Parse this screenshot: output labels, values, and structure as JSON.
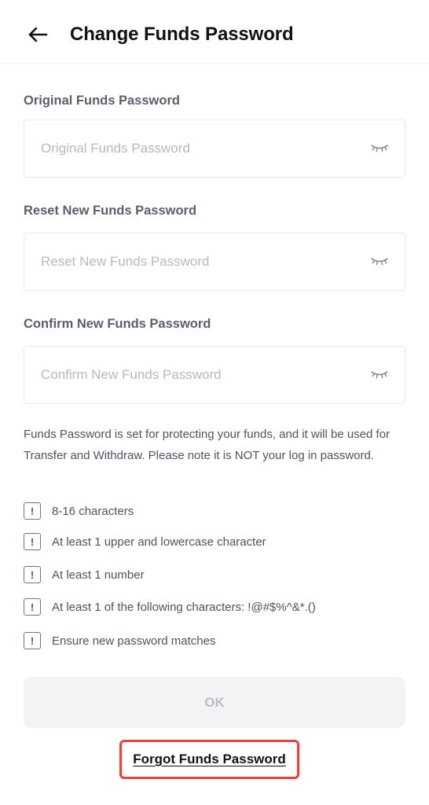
{
  "header": {
    "back_icon": "arrow-left-icon",
    "title": "Change Funds Password"
  },
  "fields": [
    {
      "label": "Original Funds Password",
      "placeholder": "Original Funds Password",
      "value": "",
      "toggle_icon": "eye-closed-icon"
    },
    {
      "label": "Reset New Funds Password",
      "placeholder": "Reset New Funds Password",
      "value": "",
      "toggle_icon": "eye-closed-icon"
    },
    {
      "label": "Confirm New Funds Password",
      "placeholder": "Confirm New Funds Password",
      "value": "",
      "toggle_icon": "eye-closed-icon"
    }
  ],
  "note": "Funds Password is set for protecting your funds, and it will be used for Transfer and Withdraw. Please note it is NOT your log in password.",
  "requirements": {
    "icon": "exclamation-box-icon",
    "icon_glyph": "!",
    "items": [
      "8-16 characters",
      "At least 1 upper and lowercase character",
      "At least 1 number",
      "At least 1 of the following characters: !@#$%^&*.()",
      "Ensure new password matches"
    ]
  },
  "actions": {
    "ok_label": "OK",
    "forgot_label": "Forgot Funds Password"
  },
  "colors": {
    "title": "#111214",
    "label": "#5a5f6b",
    "placeholder": "#b6b9c0",
    "button_disabled_bg": "#f2f3f5",
    "button_disabled_text": "#b9bcc2",
    "highlight_frame": "#e5433e"
  }
}
